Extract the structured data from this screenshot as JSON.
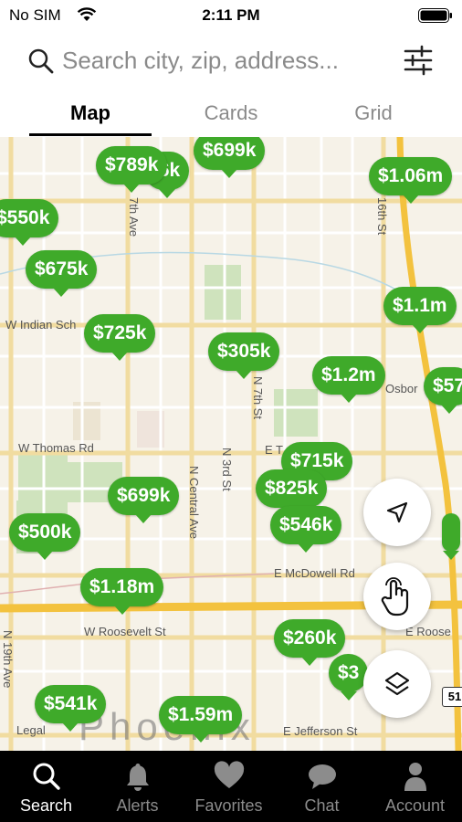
{
  "status_bar": {
    "carrier": "No SIM",
    "time": "2:11 PM"
  },
  "search": {
    "placeholder": "Search city, zip, address..."
  },
  "tabs": [
    {
      "label": "Map",
      "active": true
    },
    {
      "label": "Cards",
      "active": false
    },
    {
      "label": "Grid",
      "active": false
    }
  ],
  "map": {
    "roads": {
      "w_indian_school": "W Indian Sch",
      "w_thomas": "W Thomas Rd",
      "e_thomas": "E T",
      "e_mcdowell": "E McDowell Rd",
      "w_roosevelt": "W Roosevelt St",
      "e_roosevelt": "E Roose",
      "e_jefferson": "E Jefferson St",
      "osborn": "Osbor",
      "n_7th_ave": "7th Ave",
      "n_16th_st": "16th St",
      "n_7th_st": "N 7th St",
      "n_3rd_st": "N 3rd St",
      "n_central_ave": "N Central Ave",
      "n_19th_ave": "N 19th Ave"
    },
    "city_label": "Phoenix",
    "legal": "Legal",
    "route_badge": "51",
    "pins": [
      {
        "price": "$789k"
      },
      {
        "price": ".6k"
      },
      {
        "price": "$699k"
      },
      {
        "price": "$1.06m"
      },
      {
        "price": "$550k"
      },
      {
        "price": "$675k"
      },
      {
        "price": "$1.1m"
      },
      {
        "price": "$725k"
      },
      {
        "price": "$305k"
      },
      {
        "price": "$1.2m"
      },
      {
        "price": "$57"
      },
      {
        "price": "$715k"
      },
      {
        "price": "$825k"
      },
      {
        "price": "$699k"
      },
      {
        "price": "$546k"
      },
      {
        "price": "$500k"
      },
      {
        "price": "$1.18m"
      },
      {
        "price": "$260k"
      },
      {
        "price": "$3"
      },
      {
        "price": "$541k"
      },
      {
        "price": "$1.59m"
      }
    ]
  },
  "map_controls": {
    "location": "navigation-arrow-icon",
    "draw": "hand-pointer-icon",
    "layers": "layers-icon"
  },
  "tab_bar": [
    {
      "label": "Search",
      "icon": "search-icon",
      "active": true
    },
    {
      "label": "Alerts",
      "icon": "bell-icon",
      "active": false
    },
    {
      "label": "Favorites",
      "icon": "heart-icon",
      "active": false
    },
    {
      "label": "Chat",
      "icon": "chat-icon",
      "active": false
    },
    {
      "label": "Account",
      "icon": "person-icon",
      "active": false
    }
  ],
  "colors": {
    "pin": "#3faa2a",
    "highway": "#f3c23e",
    "map_bg": "#f6f2e8",
    "park": "#cfe3bd",
    "tab_bar_bg": "#000000"
  }
}
